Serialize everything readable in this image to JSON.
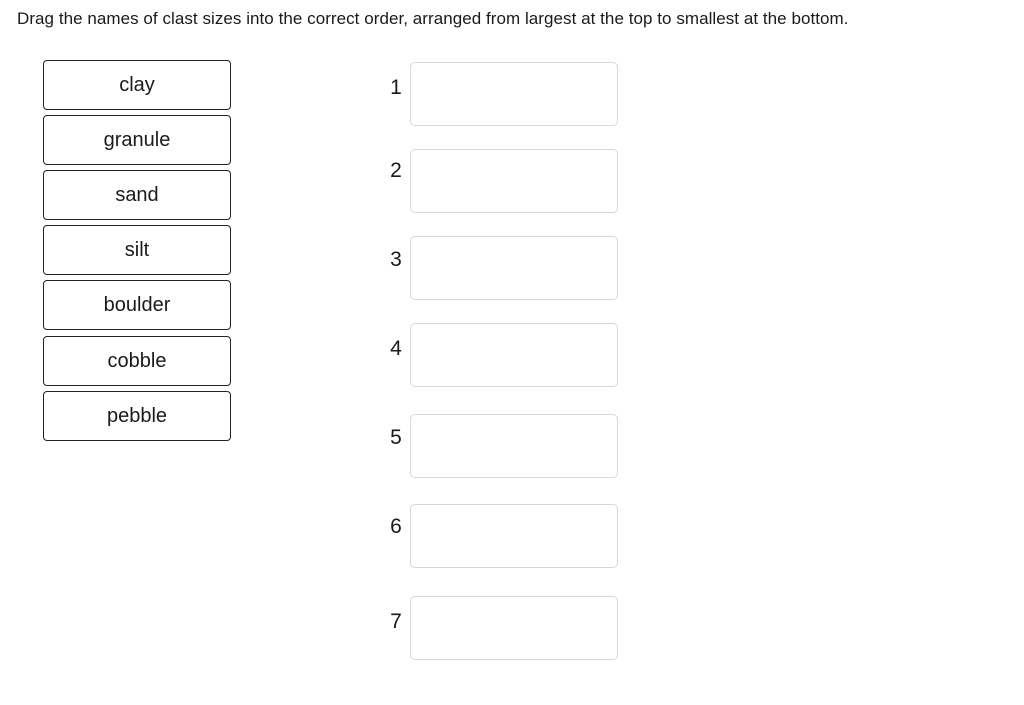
{
  "prompt": "Drag the names of clast sizes into the correct order, arranged from largest at the top to smallest at the bottom.",
  "tiles": [
    "clay",
    "granule",
    "sand",
    "silt",
    "boulder",
    "cobble",
    "pebble"
  ],
  "slots": [
    {
      "number": "1",
      "value": ""
    },
    {
      "number": "2",
      "value": ""
    },
    {
      "number": "3",
      "value": ""
    },
    {
      "number": "4",
      "value": ""
    },
    {
      "number": "5",
      "value": ""
    },
    {
      "number": "6",
      "value": ""
    },
    {
      "number": "7",
      "value": ""
    }
  ]
}
